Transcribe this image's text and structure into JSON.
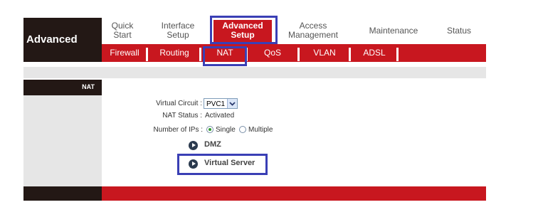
{
  "brand": {
    "title": "Advanced"
  },
  "topnav": [
    {
      "label": "Quick Start",
      "line1": "Quick",
      "line2": "Start"
    },
    {
      "label": "Interface Setup",
      "line1": "Interface",
      "line2": "Setup"
    },
    {
      "label": "Advanced Setup",
      "line1": "Advanced",
      "line2": "Setup"
    },
    {
      "label": "Access Management",
      "line1": "Access",
      "line2": "Management"
    },
    {
      "label": "Maintenance",
      "line1": "Maintenance",
      "line2": ""
    },
    {
      "label": "Status",
      "line1": "Status",
      "line2": ""
    }
  ],
  "subnav": [
    {
      "label": "Firewall"
    },
    {
      "label": "Routing"
    },
    {
      "label": "NAT"
    },
    {
      "label": "QoS"
    },
    {
      "label": "VLAN"
    },
    {
      "label": "ADSL"
    }
  ],
  "section": {
    "title": "NAT"
  },
  "form": {
    "virtual_circuit_label": "Virtual Circuit :",
    "virtual_circuit_value": "PVC1",
    "nat_status_label": "NAT Status :",
    "nat_status_value": "Activated",
    "num_ips_label": "Number of IPs :",
    "single_label": "Single",
    "multiple_label": "Multiple"
  },
  "links": {
    "dmz": "DMZ",
    "virtual_server": "Virtual Server"
  },
  "colors": {
    "accent_red": "#c8171f",
    "dark": "#231815",
    "highlight": "#3a3fb5"
  }
}
